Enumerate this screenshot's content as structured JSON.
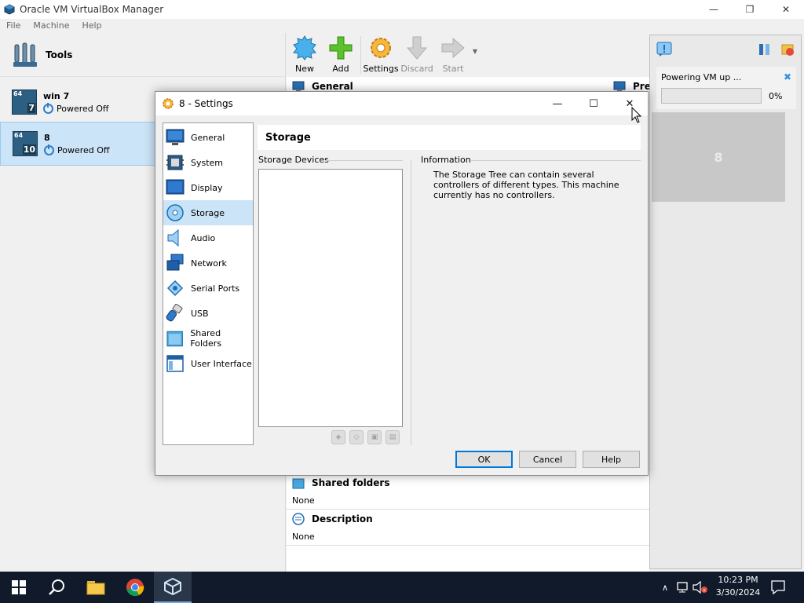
{
  "window": {
    "title": "Oracle VM VirtualBox Manager",
    "minimize": "—",
    "maximize": "❐",
    "close": "✕"
  },
  "menu": {
    "file": "File",
    "machine": "Machine",
    "help": "Help"
  },
  "tools": {
    "label": "Tools"
  },
  "vms": [
    {
      "name": "win 7",
      "state": "Powered Off",
      "bits": "64",
      "version": "7"
    },
    {
      "name": "8",
      "state": "Powered Off",
      "bits": "64",
      "version": "10"
    }
  ],
  "toolbar": {
    "new": "New",
    "add": "Add",
    "settings": "Settings",
    "discard": "Discard",
    "start": "Start"
  },
  "details": {
    "general": "General",
    "preview": "Prev",
    "shared_folders": "Shared folders",
    "shared_folders_value": "None",
    "description": "Description",
    "description_value": "None"
  },
  "notification": {
    "message": "Powering VM up ...",
    "percent_label": "0%",
    "progress": 0,
    "close": "✖"
  },
  "preview": {
    "vm_name": "8"
  },
  "dialog": {
    "title": "8 - Settings",
    "minimize": "—",
    "maximize": "☐",
    "close": "✕",
    "nav": [
      {
        "label": "General",
        "icon": "general-icon"
      },
      {
        "label": "System",
        "icon": "system-icon"
      },
      {
        "label": "Display",
        "icon": "display-icon"
      },
      {
        "label": "Storage",
        "icon": "storage-icon"
      },
      {
        "label": "Audio",
        "icon": "audio-icon"
      },
      {
        "label": "Network",
        "icon": "network-icon"
      },
      {
        "label": "Serial Ports",
        "icon": "serial-ports-icon"
      },
      {
        "label": "USB",
        "icon": "usb-icon"
      },
      {
        "label": "Shared Folders",
        "icon": "shared-folders-icon"
      },
      {
        "label": "User Interface",
        "icon": "user-interface-icon"
      }
    ],
    "selected_nav": "Storage",
    "page_title": "Storage",
    "storage_devices_label": "Storage Devices",
    "information_label": "Information",
    "information_text": "The Storage Tree can contain several controllers of different types. This machine currently has no controllers.",
    "ok": "OK",
    "cancel": "Cancel",
    "help": "Help"
  },
  "taskbar": {
    "time": "10:23 PM",
    "date": "3/30/2024"
  },
  "colors": {
    "accent": "#0078d7",
    "selection": "#cce4f7",
    "taskbar": "#101a2a",
    "progress": "#06b025"
  }
}
